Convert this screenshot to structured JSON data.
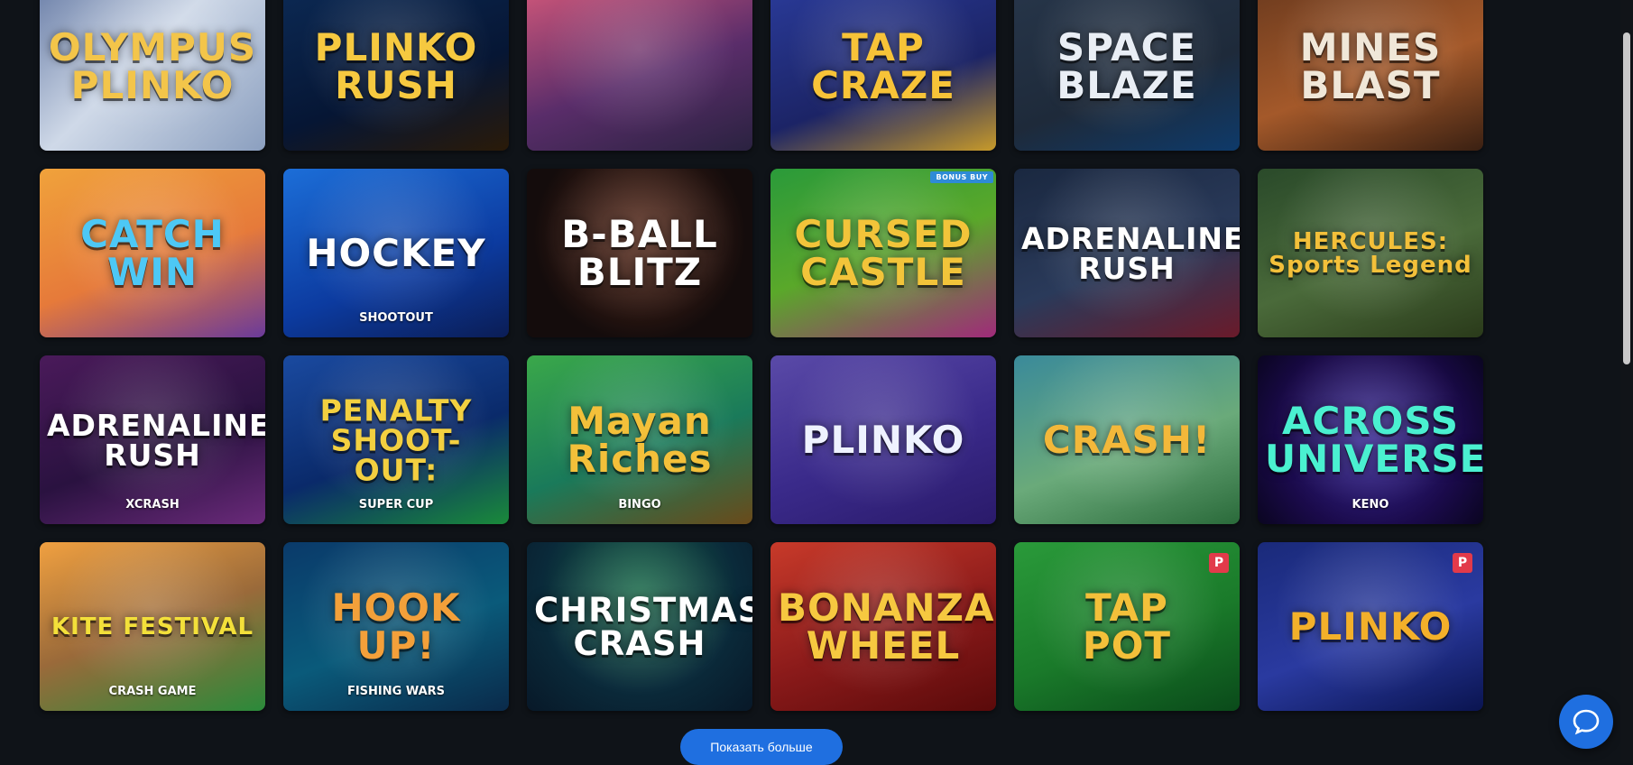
{
  "games": [
    {
      "title": "OLYMPUS\nPLINKO",
      "sub": "",
      "badge": "",
      "pbadge": "",
      "bg": "linear-gradient(135deg,#6b7fa8,#cfd9e8 45%,#8b9fbf)",
      "color": "#f3c54a"
    },
    {
      "title": "PLINKO\nRUSH",
      "sub": "",
      "badge": "",
      "pbadge": "",
      "bg": "linear-gradient(160deg,#0c2a55,#061634 60%,#2a1a08)",
      "color": "#f6c940"
    },
    {
      "title": "",
      "sub": "",
      "badge": "",
      "pbadge": "",
      "bg": "linear-gradient(160deg,#d3587a,#5a2d6a 55%,#2a2240)",
      "color": "#ffffff"
    },
    {
      "title": "TAP\nCRAZE",
      "sub": "",
      "badge": "",
      "pbadge": "",
      "bg": "linear-gradient(160deg,#2a3b9a,#1c2466 60%,#c79a2a)",
      "color": "#f7c338"
    },
    {
      "title": "SPACE\nBLAZE",
      "sub": "",
      "badge": "",
      "pbadge": "",
      "bg": "linear-gradient(160deg,#27364a,#1e2a3a 60%,#0e3a6a)",
      "color": "#e9eef5"
    },
    {
      "title": "MINES\nBLAST",
      "sub": "",
      "badge": "",
      "pbadge": "",
      "bg": "linear-gradient(160deg,#6b3a1e,#a4592a 55%,#3a2012)",
      "color": "#f0e7d8"
    },
    {
      "title": "CATCH\nWIN",
      "sub": "",
      "badge": "",
      "pbadge": "",
      "bg": "linear-gradient(160deg,#f0a23b,#e67a3a 55%,#6a3a9a)",
      "color": "#4dc8f5"
    },
    {
      "title": "HOCKEY",
      "sub": "SHOOTOUT",
      "badge": "",
      "pbadge": "",
      "bg": "linear-gradient(160deg,#1c6ed8,#0c3ba0 60%,#0b1d55)",
      "color": "#ffffff"
    },
    {
      "title": "B-BALL\nBLITZ",
      "sub": "",
      "badge": "",
      "pbadge": "",
      "bg": "radial-gradient(circle at 50% 40%,#5a2a1a,#140c0c 70%)",
      "color": "#ffffff"
    },
    {
      "title": "CURSED\nCASTLE",
      "sub": "",
      "badge": "BONUS BUY",
      "pbadge": "",
      "bg": "linear-gradient(160deg,#2a9a3a,#5aa82a 50%,#a02a7a)",
      "color": "#f2c43a"
    },
    {
      "title": "ADRENALINE\nRUSH",
      "sub": "",
      "badge": "",
      "pbadge": "",
      "bg": "linear-gradient(160deg,#1a2840,#2a3a5a 55%,#6a1a2a)",
      "color": "#ffffff"
    },
    {
      "title": "HERCULES:\nSports Legend",
      "sub": "",
      "badge": "",
      "pbadge": "",
      "bg": "linear-gradient(160deg,#2a4a2a,#4a6a3a 55%,#2a3a1a)",
      "color": "#f3c03a"
    },
    {
      "title": "ADRENALINE\nRUSH",
      "sub": "XCRASH",
      "badge": "",
      "pbadge": "",
      "bg": "linear-gradient(160deg,#4a1a5a,#2a1240 55%,#6a2a7a)",
      "color": "#ffffff"
    },
    {
      "title": "PENALTY\nSHOOT-OUT:",
      "sub": "SUPER CUP",
      "badge": "",
      "pbadge": "",
      "bg": "linear-gradient(160deg,#1a4aa0,#0a2a6a 55%,#1a8a3a)",
      "color": "#f3d040"
    },
    {
      "title": "Mayan\nRiches",
      "sub": "BINGO",
      "badge": "",
      "pbadge": "",
      "bg": "linear-gradient(160deg,#3aa84a,#1a7a5a 55%,#6a4a1a)",
      "color": "#f3c03a"
    },
    {
      "title": "PLINKO",
      "sub": "",
      "badge": "",
      "pbadge": "",
      "bg": "linear-gradient(160deg,#5a4aa8,#3a2a8a 55%,#2a1a6a)",
      "color": "#eef2ff"
    },
    {
      "title": "CRASH!",
      "sub": "",
      "badge": "",
      "pbadge": "",
      "bg": "linear-gradient(160deg,#3a8a9a,#6aaa7a 55%,#2a6a3a)",
      "color": "#f3b83a"
    },
    {
      "title": "ACROSS\nUNIVERSE",
      "sub": "KENO",
      "badge": "",
      "pbadge": "",
      "bg": "radial-gradient(circle at 50% 50%,#3a2a9a,#1a0a4a 65%,#0a0520)",
      "color": "#4af0d0"
    },
    {
      "title": "KITE FESTIVAL",
      "sub": "CRASH GAME",
      "badge": "",
      "pbadge": "",
      "bg": "linear-gradient(160deg,#f0a040,#9a6a3a 50%,#2a8a3a)",
      "color": "#f3e03a"
    },
    {
      "title": "HOOK UP!",
      "sub": "FISHING WARS",
      "badge": "",
      "pbadge": "",
      "bg": "linear-gradient(160deg,#0a3a6a,#0a5a7a 55%,#0a2a4a)",
      "color": "#f3a03a"
    },
    {
      "title": "CHRISTMAS\nCRASH",
      "sub": "",
      "badge": "",
      "pbadge": "",
      "bg": "radial-gradient(circle at 50% 30%,#1a6a4a,#0a2a3a 60%,#081828)",
      "color": "#ffffff"
    },
    {
      "title": "BONANZA\nWHEEL",
      "sub": "",
      "badge": "",
      "pbadge": "",
      "bg": "linear-gradient(160deg,#c83a2a,#8a1a1a 55%,#5a0a0a)",
      "color": "#f6c840"
    },
    {
      "title": "TAP\nPOT",
      "sub": "",
      "badge": "",
      "pbadge": "P",
      "bg": "linear-gradient(160deg,#2a9a3a,#1a7a2a 55%,#0a4a1a)",
      "color": "#f3c03a"
    },
    {
      "title": "PLINKO",
      "sub": "",
      "badge": "",
      "pbadge": "P",
      "bg": "linear-gradient(160deg,#1a2a7a,#2a3aa0 55%,#0a1450)",
      "color": "#f3b02a"
    }
  ],
  "show_more_label": "Показать больше",
  "chat_icon": "chat-bubble-icon"
}
